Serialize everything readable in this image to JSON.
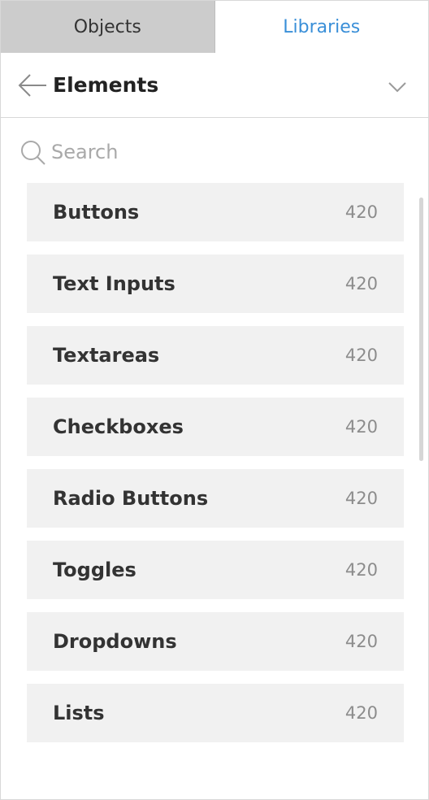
{
  "tabs": [
    {
      "label": "Objects",
      "active": false
    },
    {
      "label": "Libraries",
      "active": true
    }
  ],
  "header": {
    "title": "Elements",
    "back_icon": "arrow-left-icon",
    "collapse_icon": "chevron-down-icon"
  },
  "search": {
    "placeholder": "Search",
    "value": "",
    "icon": "search-icon"
  },
  "items": [
    {
      "label": "Buttons",
      "count": "420"
    },
    {
      "label": "Text Inputs",
      "count": "420"
    },
    {
      "label": "Textareas",
      "count": "420"
    },
    {
      "label": "Checkboxes",
      "count": "420"
    },
    {
      "label": "Radio Buttons",
      "count": "420"
    },
    {
      "label": "Toggles",
      "count": "420"
    },
    {
      "label": "Dropdowns",
      "count": "420"
    },
    {
      "label": "Lists",
      "count": "420"
    }
  ],
  "colors": {
    "accent": "#3a8fd8",
    "inactive_tab": "#cccccc",
    "item_bg": "#f1f1f1",
    "count_text": "#8c8c8c"
  }
}
